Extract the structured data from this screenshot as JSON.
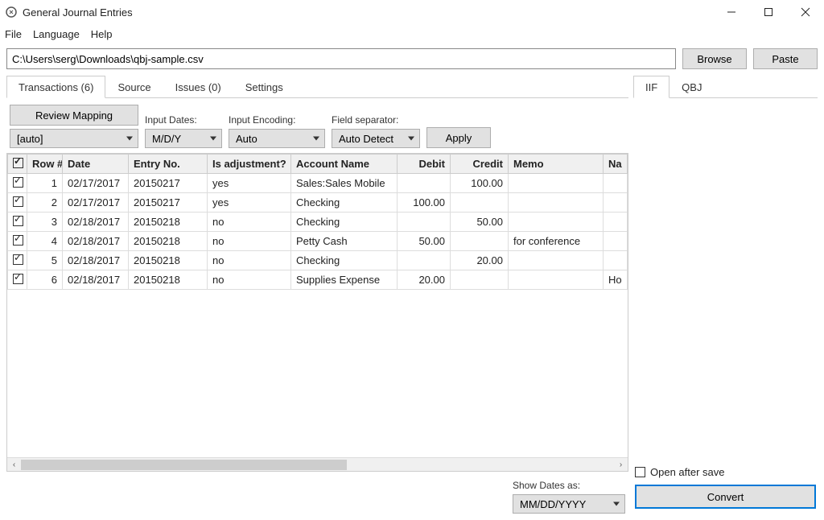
{
  "window": {
    "title": "General Journal Entries"
  },
  "menu": {
    "file": "File",
    "language": "Language",
    "help": "Help"
  },
  "file_row": {
    "path": "C:\\Users\\serg\\Downloads\\qbj-sample.csv",
    "browse": "Browse",
    "paste": "Paste"
  },
  "left_tabs": [
    {
      "label": "Transactions (6)",
      "active": true
    },
    {
      "label": "Source",
      "active": false
    },
    {
      "label": "Issues (0)",
      "active": false
    },
    {
      "label": "Settings",
      "active": false
    }
  ],
  "toolbar": {
    "review_mapping": "Review Mapping",
    "auto_select": "[auto]",
    "input_dates_label": "Input Dates:",
    "input_dates_value": "M/D/Y",
    "input_encoding_label": "Input Encoding:",
    "input_encoding_value": "Auto",
    "field_sep_label": "Field separator:",
    "field_sep_value": "Auto Detect",
    "apply": "Apply"
  },
  "table": {
    "headers": [
      "",
      "Row #",
      "Date",
      "Entry No.",
      "Is adjustment?",
      "Account Name",
      "Debit",
      "Credit",
      "Memo",
      "Na"
    ],
    "rows": [
      {
        "checked": true,
        "row": "1",
        "date": "02/17/2017",
        "entry": "20150217",
        "adj": "yes",
        "account": "Sales:Sales Mobile",
        "debit": "",
        "credit": "100.00",
        "memo": "",
        "na": ""
      },
      {
        "checked": true,
        "row": "2",
        "date": "02/17/2017",
        "entry": "20150217",
        "adj": "yes",
        "account": "Checking",
        "debit": "100.00",
        "credit": "",
        "memo": "",
        "na": ""
      },
      {
        "checked": true,
        "row": "3",
        "date": "02/18/2017",
        "entry": "20150218",
        "adj": "no",
        "account": "Checking",
        "debit": "",
        "credit": "50.00",
        "memo": "",
        "na": ""
      },
      {
        "checked": true,
        "row": "4",
        "date": "02/18/2017",
        "entry": "20150218",
        "adj": "no",
        "account": "Petty Cash",
        "debit": "50.00",
        "credit": "",
        "memo": "for conference",
        "na": ""
      },
      {
        "checked": true,
        "row": "5",
        "date": "02/18/2017",
        "entry": "20150218",
        "adj": "no",
        "account": "Checking",
        "debit": "",
        "credit": "20.00",
        "memo": "",
        "na": ""
      },
      {
        "checked": true,
        "row": "6",
        "date": "02/18/2017",
        "entry": "20150218",
        "adj": "no",
        "account": "Supplies Expense",
        "debit": "20.00",
        "credit": "",
        "memo": "",
        "na": "Ho"
      }
    ]
  },
  "left_bottom": {
    "show_dates_label": "Show Dates as:",
    "show_dates_value": "MM/DD/YYYY"
  },
  "right_tabs": [
    {
      "label": "IIF",
      "active": true
    },
    {
      "label": "QBJ",
      "active": false
    }
  ],
  "right_bottom": {
    "open_after_save": "Open after save",
    "convert": "Convert"
  }
}
